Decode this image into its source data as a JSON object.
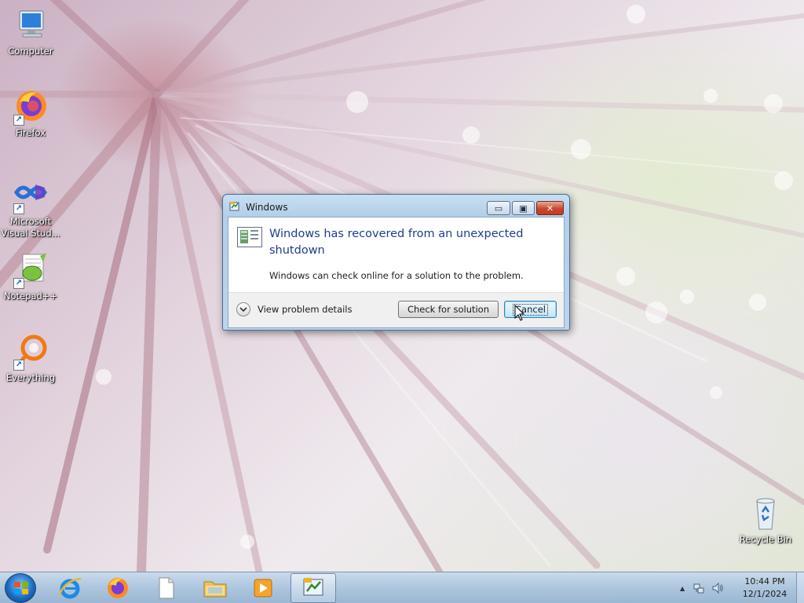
{
  "desktop": {
    "icons": [
      {
        "label": "Computer",
        "icon": "computer-icon"
      },
      {
        "label": "Firefox",
        "icon": "firefox-icon"
      },
      {
        "label": "Microsoft Visual Stud...",
        "icon": "visual-studio-icon"
      },
      {
        "label": "Notepad++",
        "icon": "notepadpp-icon"
      },
      {
        "label": "Everything",
        "icon": "everything-icon"
      },
      {
        "label": "Recycle Bin",
        "icon": "recycle-bin-icon"
      }
    ]
  },
  "dialog": {
    "title": "Windows",
    "heading": "Windows has recovered from an unexpected shutdown",
    "message": "Windows can check online for a solution to the problem.",
    "details_label": "View problem details",
    "check_button": "Check for solution",
    "cancel_button": "Cancel",
    "minimize_glyph": "▭",
    "maximize_glyph": "▣",
    "close_glyph": "✕"
  },
  "taskbar": {
    "pinned": [
      {
        "icon": "internet-explorer-icon"
      },
      {
        "icon": "firefox-icon"
      },
      {
        "icon": "blank-document-icon"
      },
      {
        "icon": "file-explorer-icon"
      },
      {
        "icon": "media-player-icon"
      },
      {
        "icon": "problem-reports-icon",
        "active": true
      }
    ],
    "tray": {
      "overflow_glyph": "▲",
      "time": "10:44 PM",
      "date": "12/1/2024"
    }
  },
  "colors": {
    "dialog_heading": "#1e3d8f",
    "close_button": "#c73b1f",
    "taskbar": "#aac4de"
  }
}
